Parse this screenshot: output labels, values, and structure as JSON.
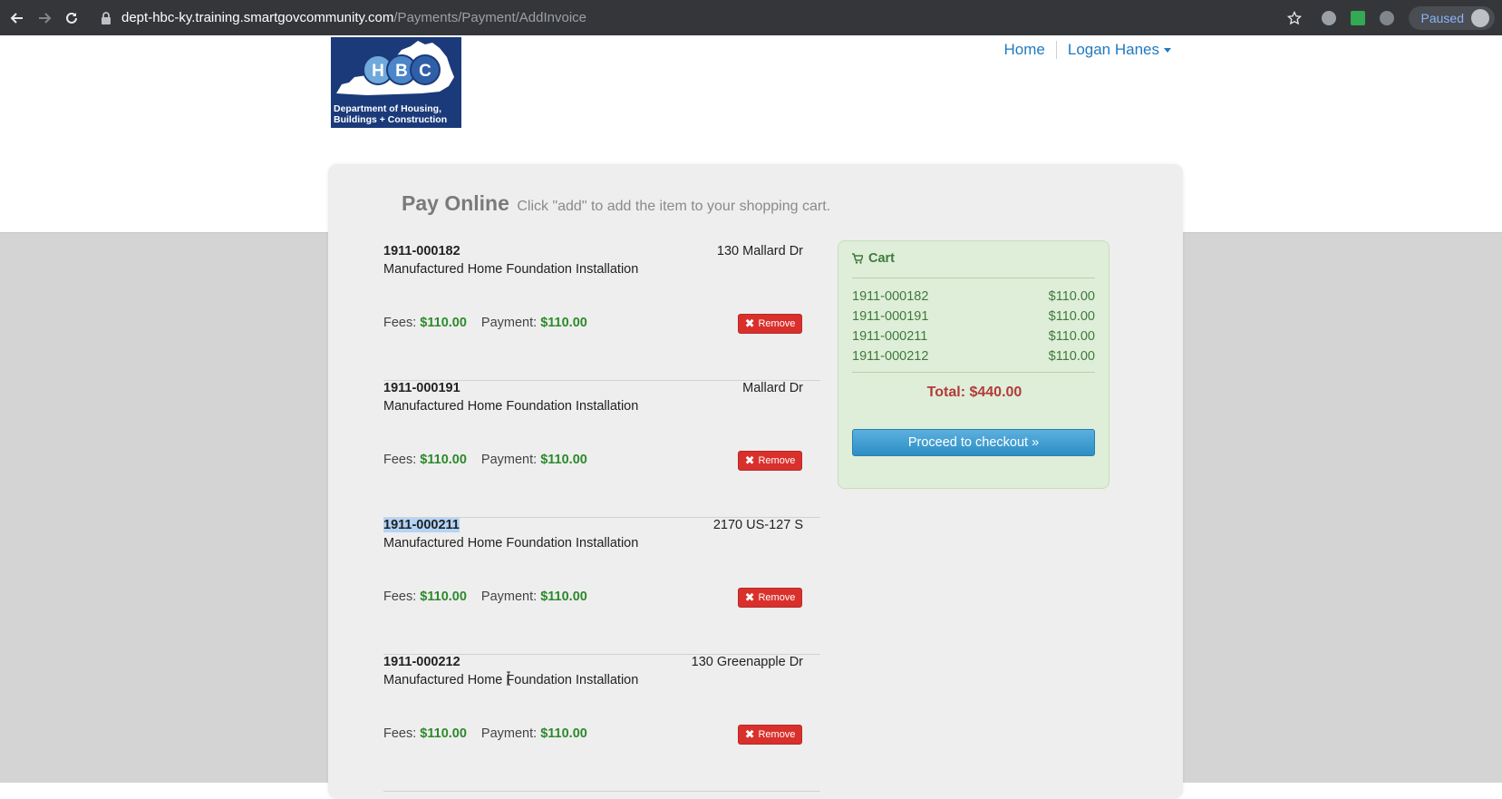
{
  "browser": {
    "url_host": "dept-hbc-ky.training.smartgovcommunity.com",
    "url_path": "/Payments/Payment/AddInvoice",
    "profile_status": "Paused"
  },
  "logo": {
    "letters": [
      "H",
      "B",
      "C"
    ],
    "caption_line1": "Department of Housing,",
    "caption_line2": "Buildings + Construction"
  },
  "nav": {
    "home": "Home",
    "user": "Logan Hanes"
  },
  "heading": {
    "title": "Pay Online",
    "subtitle": "Click \"add\" to add the item to your shopping cart."
  },
  "items": [
    {
      "number": "1911-000182",
      "address": "130 Mallard Dr",
      "description": "Manufactured Home Foundation Installation",
      "fees_label": "Fees:",
      "fees": "$110.00",
      "payment_label": "Payment:",
      "payment": "$110.00",
      "remove_label": "Remove"
    },
    {
      "number": "1911-000191",
      "address": "Mallard Dr",
      "description": "Manufactured Home Foundation Installation",
      "fees_label": "Fees:",
      "fees": "$110.00",
      "payment_label": "Payment:",
      "payment": "$110.00",
      "remove_label": "Remove"
    },
    {
      "number": "1911-000211",
      "address": "2170 US-127 S",
      "description": "Manufactured Home Foundation Installation",
      "fees_label": "Fees:",
      "fees": "$110.00",
      "payment_label": "Payment:",
      "payment": "$110.00",
      "remove_label": "Remove"
    },
    {
      "number": "1911-000212",
      "address": "130 Greenapple Dr",
      "description": "Manufactured Home Foundation Installation",
      "fees_label": "Fees:",
      "fees": "$110.00",
      "payment_label": "Payment:",
      "payment": "$110.00",
      "remove_label": "Remove"
    }
  ],
  "cart": {
    "title": "Cart",
    "rows": [
      {
        "number": "1911-000182",
        "amount": "$110.00"
      },
      {
        "number": "1911-000191",
        "amount": "$110.00"
      },
      {
        "number": "1911-000211",
        "amount": "$110.00"
      },
      {
        "number": "1911-000212",
        "amount": "$110.00"
      }
    ],
    "total": "Total: $440.00",
    "checkout_label": "Proceed to checkout »"
  },
  "colors": {
    "money_green": "#2c8a2c",
    "remove_red": "#d9302c",
    "checkout_blue": "#2d8ec4",
    "cart_bg": "#dfeed8",
    "link_blue": "#1f7ac0",
    "logo_navy": "#1b3a7a"
  }
}
